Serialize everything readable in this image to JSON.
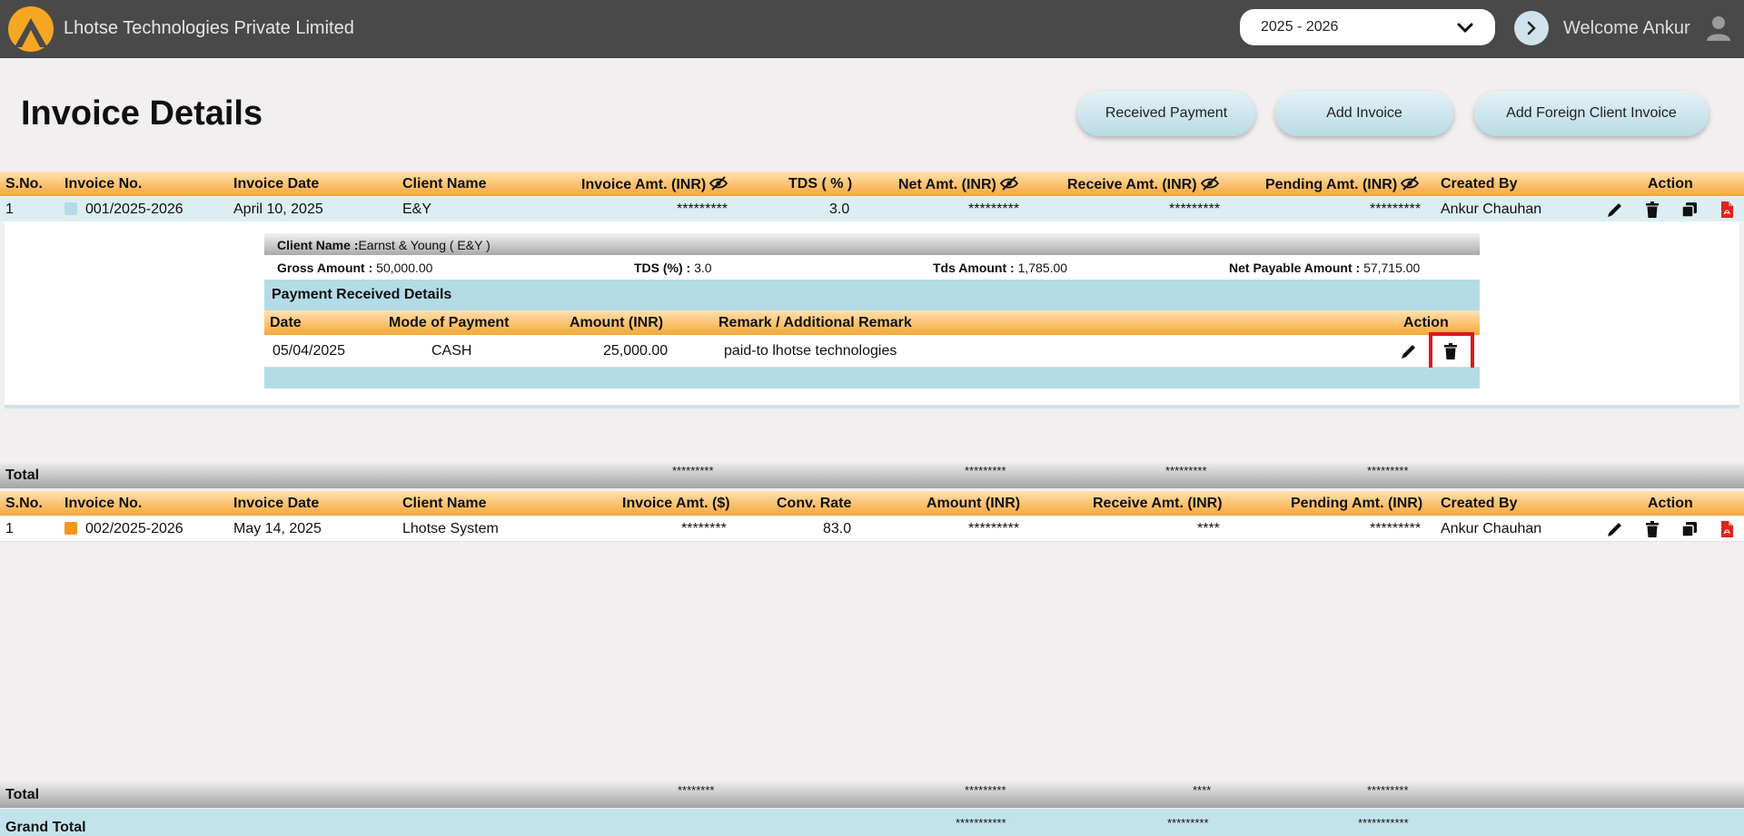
{
  "header": {
    "company": "Lhotse Technologies Private Limited",
    "fiscal_year": "2025 - 2026",
    "welcome": "Welcome Ankur"
  },
  "page": {
    "title": "Invoice Details",
    "buttons": {
      "received_payment": "Received Payment",
      "add_invoice": "Add Invoice",
      "add_foreign": "Add Foreign Client Invoice"
    }
  },
  "domestic_table": {
    "columns": [
      "S.No.",
      "Invoice No.",
      "Invoice Date",
      "Client Name",
      "Invoice Amt. (INR)",
      "TDS ( % )",
      "Net Amt. (INR)",
      "Receive Amt. (INR)",
      "Pending Amt. (INR)",
      "Created By",
      "Action"
    ],
    "row": {
      "sno": "1",
      "invoice_no": "001/2025-2026",
      "date": "April 10, 2025",
      "client": "E&Y",
      "invoice_amt": "*********",
      "tds": "3.0",
      "net_amt": "*********",
      "receive_amt": "*********",
      "pending_amt": "*********",
      "created_by": "Ankur Chauhan",
      "status_color": "#b3dce6"
    },
    "detail": {
      "client_name_label": "Client Name :",
      "client_name": "Earnst & Young ( E&Y )",
      "gross_label": "Gross Amount :",
      "gross": "50,000.00",
      "tds_label": "TDS (%) :",
      "tds": "3.0",
      "tds_amount_label": "Tds Amount :",
      "tds_amount": "1,785.00",
      "net_label": "Net Payable Amount :",
      "net": "57,715.00",
      "payments_title": "Payment Received Details",
      "payment_columns": [
        "Date",
        "Mode of Payment",
        "Amount (INR)",
        "Remark / Additional Remark",
        "Action"
      ],
      "payment": {
        "date": "05/04/2025",
        "mode": "CASH",
        "amount": "25,000.00",
        "remark": "paid-to lhotse technologies"
      }
    },
    "total": {
      "label": "Total",
      "invoice_amt": "*********",
      "net_amt": "*********",
      "receive_amt": "*********",
      "pending_amt": "*********"
    }
  },
  "foreign_table": {
    "columns": [
      "S.No.",
      "Invoice No.",
      "Invoice Date",
      "Client Name",
      "Invoice Amt. ($)",
      "Conv. Rate",
      "Amount (INR)",
      "Receive Amt. (INR)",
      "Pending Amt. (INR)",
      "Created By",
      "Action"
    ],
    "row": {
      "sno": "1",
      "invoice_no": "002/2025-2026",
      "date": "May 14, 2025",
      "client": "Lhotse System",
      "invoice_amt": "********",
      "conv_rate": "83.0",
      "amount": "*********",
      "receive_amt": "****",
      "pending_amt": "*********",
      "created_by": "Ankur Chauhan",
      "status_color": "#f7941d"
    },
    "total": {
      "label": "Total",
      "invoice_amt": "********",
      "amount": "*********",
      "receive_amt": "****",
      "pending_amt": "*********"
    }
  },
  "grand_total": {
    "label": "Grand Total",
    "amount": "***********",
    "receive_amt": "*********",
    "pending_amt": "***********"
  }
}
